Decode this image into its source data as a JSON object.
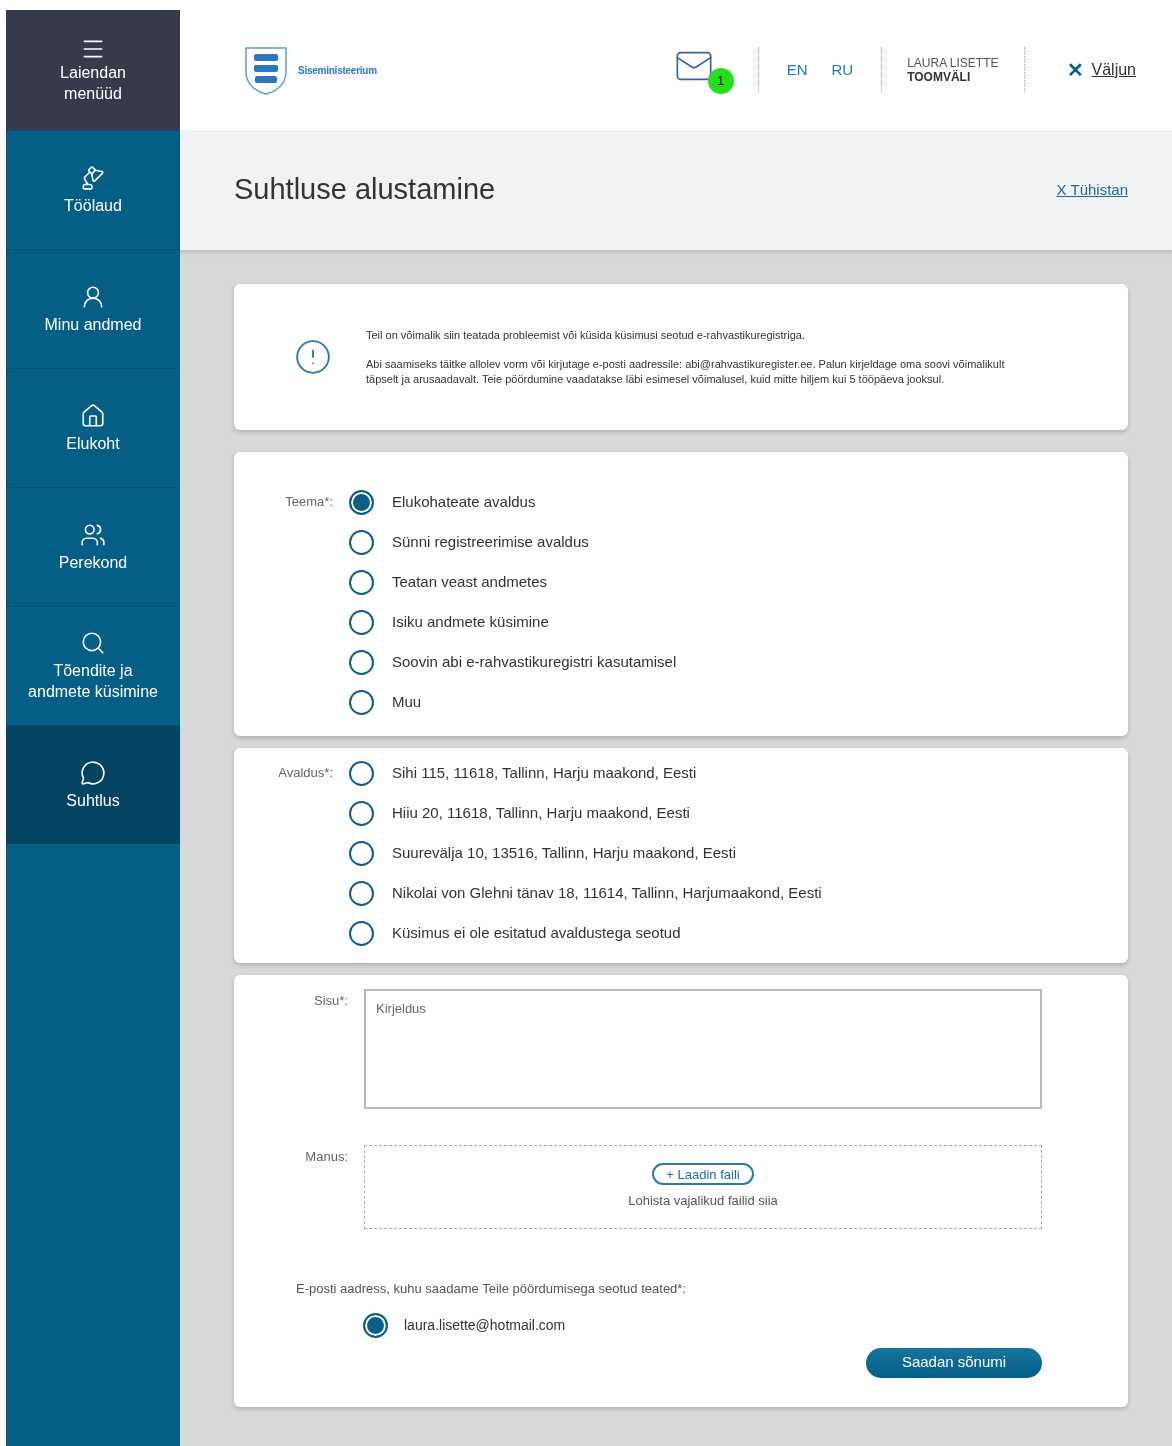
{
  "sidebar": {
    "menu_label": "Laiendan menüüd",
    "items": [
      {
        "kind": "desk",
        "label": "Töölaud",
        "selected": false
      },
      {
        "kind": "person",
        "label": "Minu andmed",
        "selected": false
      },
      {
        "kind": "home",
        "label": "Elukoht",
        "selected": false
      },
      {
        "kind": "family",
        "label": "Perekond",
        "selected": false
      },
      {
        "kind": "search",
        "label": "Tõendite ja andmete küsimine",
        "selected": false
      },
      {
        "kind": "chat",
        "label": "Suhtlus",
        "selected": true
      }
    ]
  },
  "header": {
    "logo_text": "Siseministeerium",
    "mail_count": "1",
    "languages": [
      "EN",
      "RU"
    ],
    "user_first": "LAURA LISETTE",
    "user_last": "TOOMVÄLI",
    "logout_icon": "✕",
    "logout": "Väljun"
  },
  "page": {
    "title": "Suhtluse alustamine",
    "cancel": "X Tühistan"
  },
  "info": {
    "paragraphs": [
      "Teil on võimalik siin teatada probleemist või küsida küsimusi seotud e-rahvastikuregistriga.",
      "Abi saamiseks täitke allolev vorm või kirjutage e-posti aadressile: abi@rahvastikuregister.ee. Palun kirjeldage oma soovi võimalikult täpselt ja arusaadavalt. Teie pöördumine vaadatakse läbi esimesel võimalusel, kuid mitte hiljem kui 5 tööpäeva jooksul."
    ]
  },
  "topic": {
    "label": "Teema*:",
    "options": [
      {
        "label": "Elukohateate avaldus",
        "selected": true
      },
      {
        "label": "Sünni registreerimise avaldus",
        "selected": false
      },
      {
        "label": "Teatan veast andmetes",
        "selected": false
      },
      {
        "label": "Isiku andmete küsimine",
        "selected": false
      },
      {
        "label": "Soovin abi e-rahvastikuregistri kasutamisel",
        "selected": false
      },
      {
        "label": "Muu",
        "selected": false
      }
    ]
  },
  "application": {
    "label": "Avaldus*:",
    "options": [
      {
        "label": "Sihi 115, 11618, Tallinn, Harju maakond, Eesti",
        "selected": false
      },
      {
        "label": "Hiiu 20, 11618, Tallinn, Harju maakond, Eesti",
        "selected": false
      },
      {
        "label": "Suurevälja 10, 13516, Tallinn, Harju maakond, Eesti",
        "selected": false
      },
      {
        "label": "Nikolai von Glehni tänav 18, 11614, Tallinn, Harjumaakond, Eesti",
        "selected": false
      },
      {
        "label": "Küsimus ei ole esitatud avaldustega seotud",
        "selected": false
      }
    ]
  },
  "content": {
    "label": "Sisu*:",
    "placeholder": "Kirjeldus"
  },
  "attachment": {
    "label": "Manus:",
    "button": "+ Laadin faili",
    "hint": "Lohista vajalikud failid siia"
  },
  "email": {
    "label": "E-posti aadress, kuhu saadame Teile pöördumisega seotud teated*:",
    "options": [
      {
        "label": "laura.lisette@hotmail.com",
        "selected": true
      }
    ]
  },
  "submit": "Saadan sõnumi"
}
